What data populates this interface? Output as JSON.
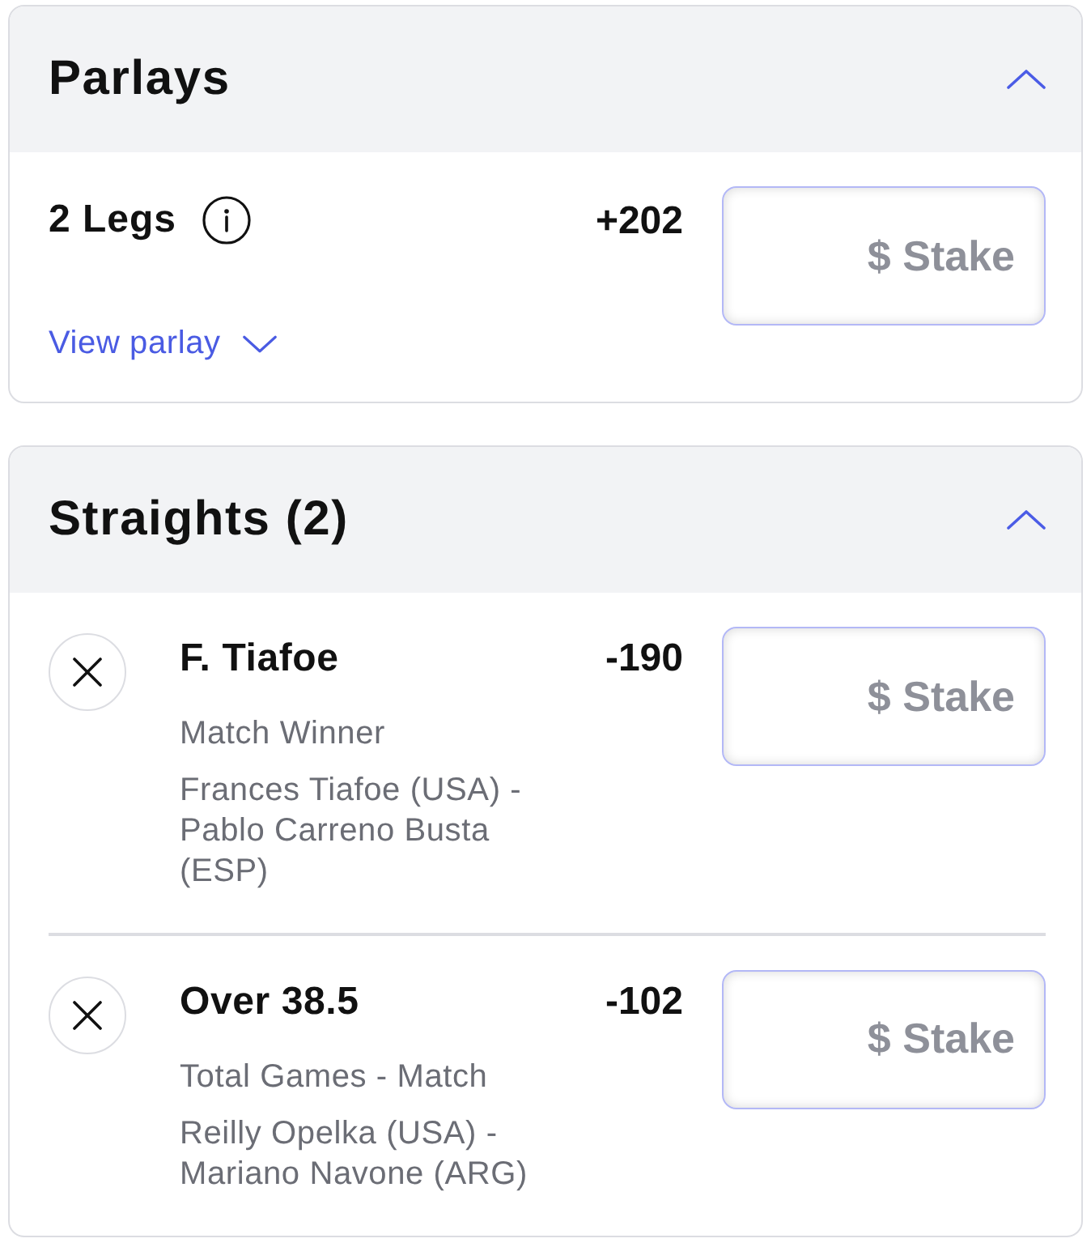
{
  "sections": [
    {
      "kind": "parlays",
      "title": "Parlays",
      "expanded": true,
      "parlay": {
        "legs_label": "2 Legs",
        "odds": "+202",
        "stake": {
          "placeholder": "$ Stake"
        },
        "view_link": "View parlay",
        "expanded": false
      }
    },
    {
      "kind": "straights",
      "title": "Straights (2)",
      "expanded": true,
      "bets": [
        {
          "selection": "F. Tiafoe",
          "odds": "-190",
          "market": "Match Winner",
          "event": "Frances Tiafoe (USA) - Pablo Carreno Busta (ESP)",
          "stake": {
            "placeholder": "$ Stake"
          }
        },
        {
          "selection": "Over 38.5",
          "odds": "-102",
          "market": "Total Games - Match",
          "event": "Reilly Opelka (USA) - Mariano Navone (ARG)",
          "stake": {
            "placeholder": "$ Stake"
          }
        }
      ]
    }
  ]
}
